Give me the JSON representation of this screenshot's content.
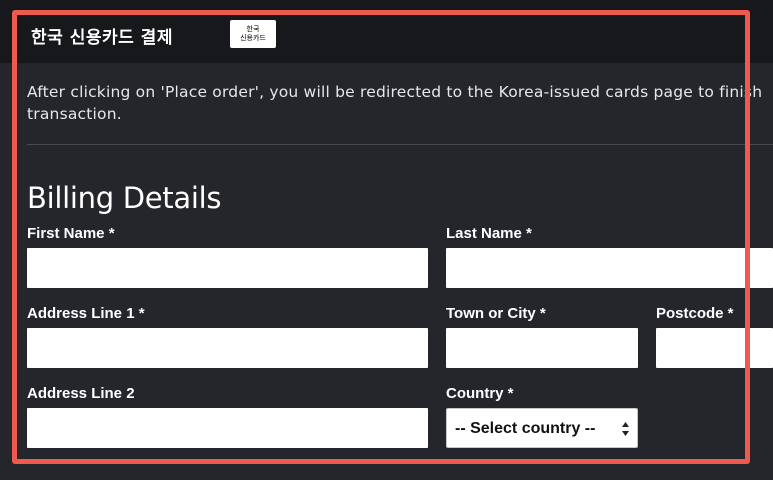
{
  "payment_method": {
    "title": "한국 신용카드 결제",
    "logo_line1": "한국",
    "logo_line2": "신용카드"
  },
  "notice": {
    "line1": "After clicking on 'Place order', you will be redirected to the Korea-issued cards page to finish",
    "line2": "transaction."
  },
  "billing": {
    "title": "Billing Details",
    "first_name_label": "First Name *",
    "last_name_label": "Last Name *",
    "address1_label": "Address Line 1 *",
    "town_label": "Town or City *",
    "postcode_label": "Postcode *",
    "address2_label": "Address Line 2",
    "country_label": "Country *",
    "country_selected": "-- Select country --"
  },
  "colors": {
    "background": "#25262b",
    "header": "#17181b",
    "highlight": "#ef5a4e"
  }
}
